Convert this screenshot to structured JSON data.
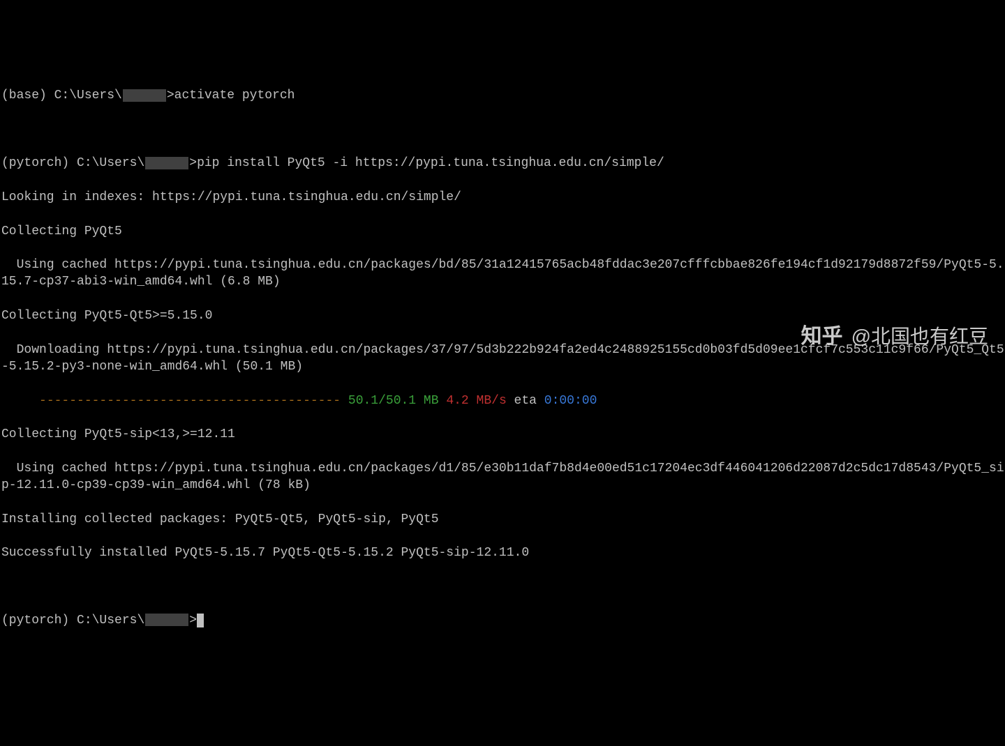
{
  "prompt1": {
    "env": "(base)",
    "path_pre": "C:\\Users\\",
    "path_post": ">",
    "cmd": "activate pytorch"
  },
  "prompt2": {
    "env": "(pytorch)",
    "path_pre": "C:\\Users\\",
    "path_post": ">",
    "cmd": "pip install PyQt5 -i https://pypi.tuna.tsinghua.edu.cn/simple/"
  },
  "out": {
    "looking": "Looking in indexes: https://pypi.tuna.tsinghua.edu.cn/simple/",
    "collect1": "Collecting PyQt5",
    "cached1": "  Using cached https://pypi.tuna.tsinghua.edu.cn/packages/bd/85/31a12415765acb48fddac3e207cfffcbbae826fe194cf1d92179d8872f59/PyQt5-5.15.7-cp37-abi3-win_amd64.whl (6.8 MB)",
    "collect2": "Collecting PyQt5-Qt5>=5.15.0",
    "download1": "  Downloading https://pypi.tuna.tsinghua.edu.cn/packages/37/97/5d3b222b924fa2ed4c2488925155cd0b03fd5d09ee1cfcf7c553c11c9f66/PyQt5_Qt5-5.15.2-py3-none-win_amd64.whl (50.1 MB)",
    "progress_bar": "     ----------------------------------------",
    "progress_mb": " 50.1/50.1 MB",
    "progress_speed": " 4.2 MB/s",
    "progress_eta_label": " eta",
    "progress_eta": " 0:00:00",
    "collect3": "Collecting PyQt5-sip<13,>=12.11",
    "cached2": "  Using cached https://pypi.tuna.tsinghua.edu.cn/packages/d1/85/e30b11daf7b8d4e00ed51c17204ec3df446041206d22087d2c5dc17d8543/PyQt5_sip-12.11.0-cp39-cp39-win_amd64.whl (78 kB)",
    "installing": "Installing collected packages: PyQt5-Qt5, PyQt5-sip, PyQt5",
    "success": "Successfully installed PyQt5-5.15.7 PyQt5-Qt5-5.15.2 PyQt5-sip-12.11.0"
  },
  "prompt3": {
    "env": "(pytorch)",
    "path_pre": "C:\\Users\\",
    "path_post": ">"
  },
  "watermark": {
    "logo": "知乎",
    "handle": "@北国也有红豆"
  }
}
